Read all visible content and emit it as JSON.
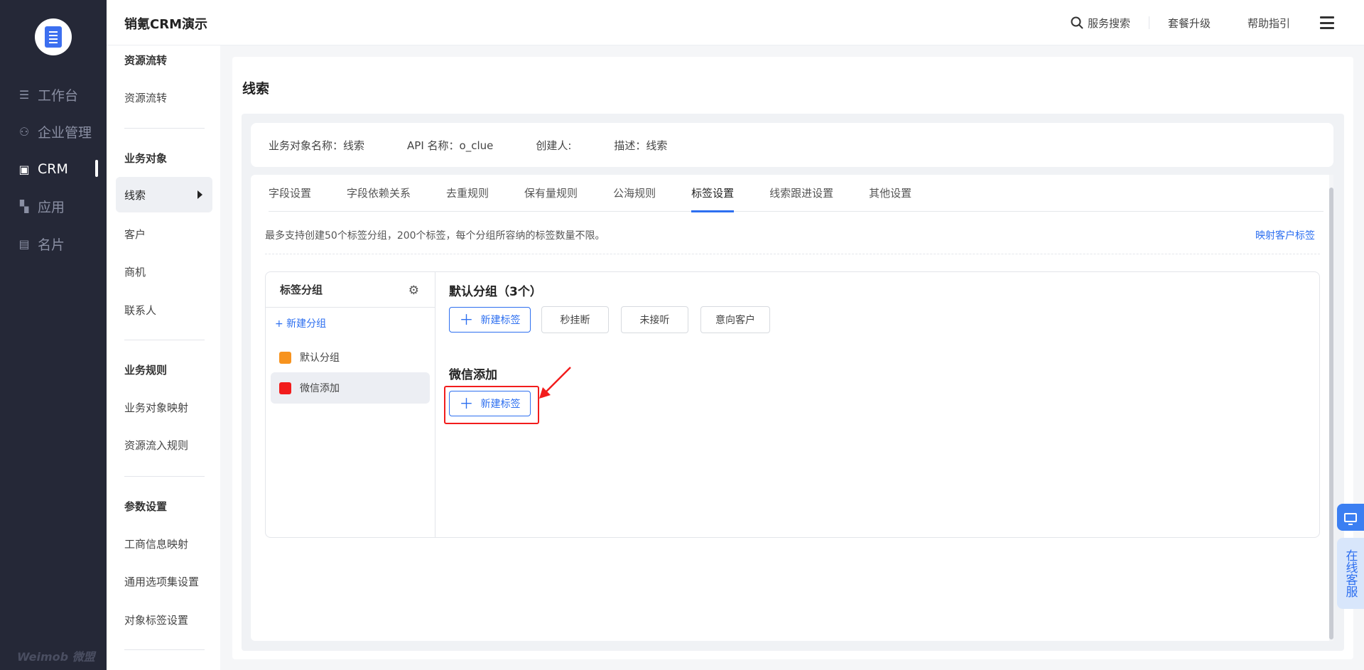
{
  "nav": {
    "items": [
      {
        "label": "工作台",
        "icon": "workbench-icon"
      },
      {
        "label": "企业管理",
        "icon": "org-icon"
      },
      {
        "label": "CRM",
        "icon": "crm-icon"
      },
      {
        "label": "应用",
        "icon": "apps-icon"
      },
      {
        "label": "名片",
        "icon": "card-icon"
      }
    ],
    "active": "CRM",
    "brand": "Weimob 微盟"
  },
  "topbar": {
    "title": "销氪CRM演示",
    "search": "服务搜索",
    "upgrade": "套餐升级",
    "help": "帮助指引"
  },
  "subnav": {
    "headers": [
      "资源流转",
      "业务对象",
      "业务规则",
      "参数设置"
    ],
    "items": {
      "resource_flow": "资源流转",
      "clue": "线索",
      "customer": "客户",
      "opportunity": "商机",
      "contact": "联系人",
      "object_mapping": "业务对象映射",
      "resource_inflow": "资源流入规则",
      "biz_info_mapping": "工商信息映射",
      "option_set": "通用选项集设置",
      "object_tag": "对象标签设置"
    }
  },
  "main": {
    "title": "线索",
    "info": {
      "object_name": "业务对象名称：线索",
      "api_name": "API 名称：o_clue",
      "creator": "创建人:",
      "desc": "描述：线索"
    },
    "tabs": [
      "字段设置",
      "字段依赖关系",
      "去重规则",
      "保有量规则",
      "公海规则",
      "标签设置",
      "线索跟进设置",
      "其他设置"
    ],
    "active_tab": "标签设置",
    "hint": "最多支持创建50个标签分组，200个标签，每个分组所容纳的标签数量不限。",
    "map_link": "映射客户标签",
    "group_panel": {
      "title": "标签分组",
      "new_group": "+ 新建分组",
      "groups": [
        {
          "name": "默认分组",
          "color": "#f7931e"
        },
        {
          "name": "微信添加",
          "color": "#f21c1c"
        }
      ],
      "active_group": "微信添加"
    },
    "sections": [
      {
        "title": "默认分组（3个）",
        "new_label": "新建标签",
        "tags": [
          "秒挂断",
          "未接听",
          "意向客户"
        ]
      },
      {
        "title": "微信添加",
        "new_label": "新建标签",
        "tags": []
      }
    ]
  },
  "float": {
    "online_service": "在线客服"
  },
  "colors": {
    "accent": "#2d6ff0",
    "nav_bg": "#252837",
    "highlight": "#f21c1c"
  }
}
